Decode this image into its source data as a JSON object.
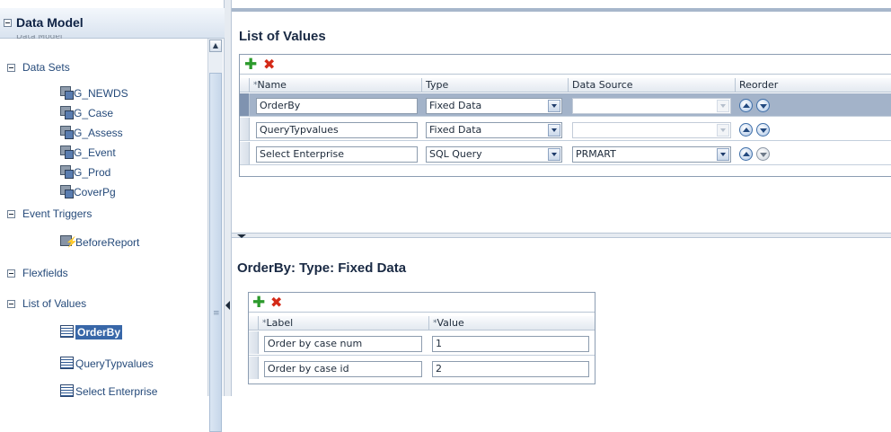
{
  "navigator": {
    "title": "Data Model",
    "subtitle": "Data Model",
    "groups": {
      "data_sets": "Data Sets",
      "event_triggers": "Event Triggers",
      "flexfields": "Flexfields",
      "list_of_values": "List of Values"
    },
    "data_sets": [
      "G_NEWDS",
      "G_Case",
      "G_Assess",
      "G_Event",
      "G_Prod",
      "CoverPg"
    ],
    "event_triggers": [
      "BeforeReport"
    ],
    "lovs": [
      "OrderBy",
      "QueryTypvalues",
      "Select Enterprise"
    ],
    "selected_lov": "OrderBy"
  },
  "lov_section": {
    "title": "List of Values",
    "columns": {
      "name": "Name",
      "type": "Type",
      "data_source": "Data Source",
      "reorder": "Reorder"
    },
    "required_marker": "*",
    "rows": [
      {
        "name": "OrderBy",
        "type": "Fixed Data",
        "data_source": "",
        "selected": true
      },
      {
        "name": "QueryTypvalues",
        "type": "Fixed Data",
        "data_source": ""
      },
      {
        "name": "Select Enterprise",
        "type": "SQL Query",
        "data_source": "PRMART"
      }
    ]
  },
  "detail_section": {
    "title": "OrderBy: Type: Fixed Data",
    "columns": {
      "label": "Label",
      "value": "Value"
    },
    "required_marker": "*",
    "rows": [
      {
        "label": "Order by case num",
        "value": "1"
      },
      {
        "label": "Order by case id",
        "value": "2"
      }
    ]
  },
  "icons": {
    "add": "add-icon",
    "delete": "delete-icon",
    "move_up": "move-up-icon",
    "move_down": "move-down-icon"
  },
  "colors": {
    "selection": "#3867a8",
    "add_green": "#2c9a2c",
    "delete_red": "#d42a18"
  }
}
